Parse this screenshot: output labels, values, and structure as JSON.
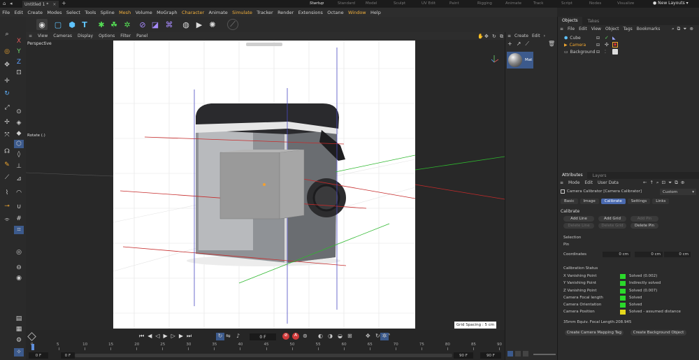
{
  "window": {
    "doc_tab": "Untitled 1 *",
    "layout": "New Layouts"
  },
  "layouts": [
    "Startup",
    "Standard",
    "Model",
    "Sculpt",
    "UV Edit",
    "Paint",
    "Rigging",
    "Animate",
    "Track",
    "Script",
    "Nodes",
    "Visualize"
  ],
  "menu": [
    "File",
    "Edit",
    "Create",
    "Modes",
    "Select",
    "Tools",
    "Spline",
    "Mesh",
    "Volume",
    "MoGraph",
    "Character",
    "Animate",
    "Simulate",
    "Tracker",
    "Render",
    "Extensions",
    "Octane",
    "Window",
    "Help"
  ],
  "menu_highlight": [
    "Mesh",
    "Character",
    "Simulate",
    "Window"
  ],
  "viewport": {
    "menu": [
      "View",
      "Cameras",
      "Display",
      "Options",
      "Filter",
      "Panel"
    ],
    "label": "Perspective",
    "tool_label": "Rotate (.)",
    "grid_spacing": "Grid Spacing : 5 cm"
  },
  "timeline": {
    "ticks": [
      "0",
      "5",
      "10",
      "15",
      "20",
      "25",
      "30",
      "35",
      "40",
      "45",
      "50",
      "55",
      "60",
      "65",
      "70",
      "75",
      "80",
      "85",
      "90"
    ],
    "frame": "0 F",
    "start": "0 F",
    "start2": "0 F",
    "end": "90 F",
    "end2": "90 F"
  },
  "material": {
    "menu": [
      "Create",
      "Edit"
    ],
    "name": "Mat"
  },
  "objects": {
    "tabs": [
      "Objects",
      "Takes"
    ],
    "menu": [
      "File",
      "Edit",
      "View",
      "Object",
      "Tags",
      "Bookmarks"
    ],
    "items": [
      "Cube",
      "Camera",
      "Background"
    ]
  },
  "attributes": {
    "tabs": [
      "Attributes",
      "Layers"
    ],
    "menu": [
      "Mode",
      "Edit",
      "User Data"
    ],
    "title": "Camera Calibrator [Camera Calibrator]",
    "preset": "Custom",
    "subtabs": [
      "Basic",
      "Image",
      "Calibrate",
      "Settings",
      "Links"
    ],
    "active_subtab": "Calibrate",
    "section": "Calibrate",
    "buttons": [
      "Add Line",
      "Add Grid",
      "Add Pin",
      "Delete Line",
      "Delete Grid",
      "Delete Pin"
    ],
    "selection": "Selection",
    "pin": "Pin",
    "coordinates_label": "Coordinates",
    "coords": [
      "0 cm",
      "0 cm",
      "0 cm"
    ],
    "status_title": "Calibration Status",
    "status": [
      {
        "label": "X Vanishing Point",
        "value": "Solved (0.002)",
        "color": "#2bd92b"
      },
      {
        "label": "Y Vanishing Point",
        "value": "Indirectly solved",
        "color": "#2bd92b"
      },
      {
        "label": "Z Vanishing Point",
        "value": "Solved (0.007)",
        "color": "#2bd92b"
      },
      {
        "label": "Camera Focal length",
        "value": "Solved",
        "color": "#2bd92b"
      },
      {
        "label": "Camera Orientation",
        "value": "Solved",
        "color": "#2bd92b"
      },
      {
        "label": "Camera Position",
        "value": "Solved - assumed distance",
        "color": "#e6d81c"
      }
    ],
    "focal": "35mm Equiv. Focal Length:208.945",
    "bottom_buttons": [
      "Create Camera Mapping Tag",
      "Create Background Object"
    ]
  }
}
